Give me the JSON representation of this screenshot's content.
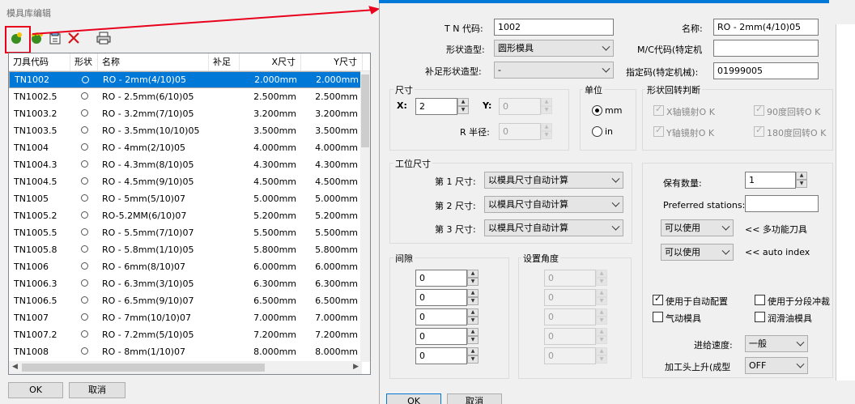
{
  "left_window": {
    "title": "模具库编辑",
    "ok": "OK",
    "cancel": "取消",
    "toolbar": [
      "new-tool-icon",
      "copy-tool-icon",
      "properties-icon",
      "delete-icon",
      "print-icon"
    ],
    "columns": [
      "刀具代码",
      "形状",
      "名称",
      "补足",
      "X尺寸",
      "Y尺寸"
    ],
    "rows": [
      {
        "code": "TN1002",
        "name": "RO - 2mm(4/10)05",
        "x": "2.000mm",
        "y": "2.000mm"
      },
      {
        "code": "TN1002.5",
        "name": "RO - 2.5mm(6/10)05",
        "x": "2.500mm",
        "y": "2.500mm"
      },
      {
        "code": "TN1003.2",
        "name": "RO - 3.2mm(7/10)05",
        "x": "3.200mm",
        "y": "3.200mm"
      },
      {
        "code": "TN1003.5",
        "name": "RO - 3.5mm(10/10)05",
        "x": "3.500mm",
        "y": "3.500mm"
      },
      {
        "code": "TN1004",
        "name": "RO - 4mm(2/10)05",
        "x": "4.000mm",
        "y": "4.000mm"
      },
      {
        "code": "TN1004.3",
        "name": "RO - 4.3mm(8/10)05",
        "x": "4.300mm",
        "y": "4.300mm"
      },
      {
        "code": "TN1004.5",
        "name": "RO - 4.5mm(9/10)05",
        "x": "4.500mm",
        "y": "4.500mm"
      },
      {
        "code": "TN1005",
        "name": "RO - 5mm(5/10)07",
        "x": "5.000mm",
        "y": "5.000mm"
      },
      {
        "code": "TN1005.2",
        "name": "RO-5.2MM(6/10)07",
        "x": "5.200mm",
        "y": "5.200mm"
      },
      {
        "code": "TN1005.5",
        "name": "RO - 5.5mm(7/10)07",
        "x": "5.500mm",
        "y": "5.500mm"
      },
      {
        "code": "TN1005.8",
        "name": "RO - 5.8mm(1/10)05",
        "x": "5.800mm",
        "y": "5.800mm"
      },
      {
        "code": "TN1006",
        "name": "RO - 6mm(8/10)07",
        "x": "6.000mm",
        "y": "6.000mm"
      },
      {
        "code": "TN1006.3",
        "name": "RO - 6.3mm(3/10)05",
        "x": "6.300mm",
        "y": "6.300mm"
      },
      {
        "code": "TN1006.5",
        "name": "RO - 6.5mm(9/10)07",
        "x": "6.500mm",
        "y": "6.500mm"
      },
      {
        "code": "TN1007",
        "name": "RO - 7mm(10/10)07",
        "x": "7.000mm",
        "y": "7.000mm"
      },
      {
        "code": "TN1007.2",
        "name": "RO - 7.2mm(5/10)05",
        "x": "7.200mm",
        "y": "7.200mm"
      },
      {
        "code": "TN1008",
        "name": "RO - 8mm(1/10)07",
        "x": "8.000mm",
        "y": "8.000mm"
      }
    ]
  },
  "dialog": {
    "tn_label": "T N 代码:",
    "tn_value": "1002",
    "shape_label": "形状造型:",
    "shape_value": "圆形模具",
    "comp_label": "补足形状造型:",
    "comp_value": "-",
    "name_label": "名称:",
    "name_value": "RO - 2mm(4/10)05",
    "mc_label": "M/C代码(特定机",
    "mc_value": "",
    "spec_label": "指定码(特定机械):",
    "spec_value": "01999005",
    "size": {
      "legend": "尺寸",
      "x_label": "X:",
      "x_value": "2",
      "y_label": "Y:",
      "y_value": "0",
      "r_label": "R 半径:",
      "r_value": "0"
    },
    "unit": {
      "legend": "单位",
      "mm": "mm",
      "in": "in"
    },
    "rotation": {
      "legend": "形状回转判断",
      "xm": "X轴镜射O K",
      "r90": "90度回转O K",
      "ym": "Y轴镜射O K",
      "r180": "180度回转O K"
    },
    "station": {
      "legend": "工位尺寸",
      "s1": "第 1 尺寸:",
      "s2": "第 2 尺寸:",
      "s3": "第 3 尺寸:",
      "opt": "以模具尺寸自动计算"
    },
    "clearance": {
      "legend": "间隙",
      "values": [
        "0",
        "0",
        "0",
        "0",
        "0"
      ]
    },
    "angle": {
      "legend": "设置角度",
      "values": [
        "0",
        "0",
        "0",
        "0",
        "0"
      ]
    },
    "qty_label": "保有数量:",
    "qty_value": "1",
    "pref_label": "Preferred stations:",
    "pref_value": "",
    "multi_value": "可以使用",
    "multi_label": "<< 多功能刀具",
    "auto_value": "可以使用",
    "auto_label": "<< auto index",
    "auto_config": "使用于自动配置",
    "seg": "使用于分段冲裁",
    "air": "气动模具",
    "lube": "润滑油模具",
    "feed_label": "进给速度:",
    "feed_value": "一般",
    "head_label": "加工头上升(成型",
    "head_value": "OFF",
    "ok": "OK",
    "cancel": "取消"
  }
}
